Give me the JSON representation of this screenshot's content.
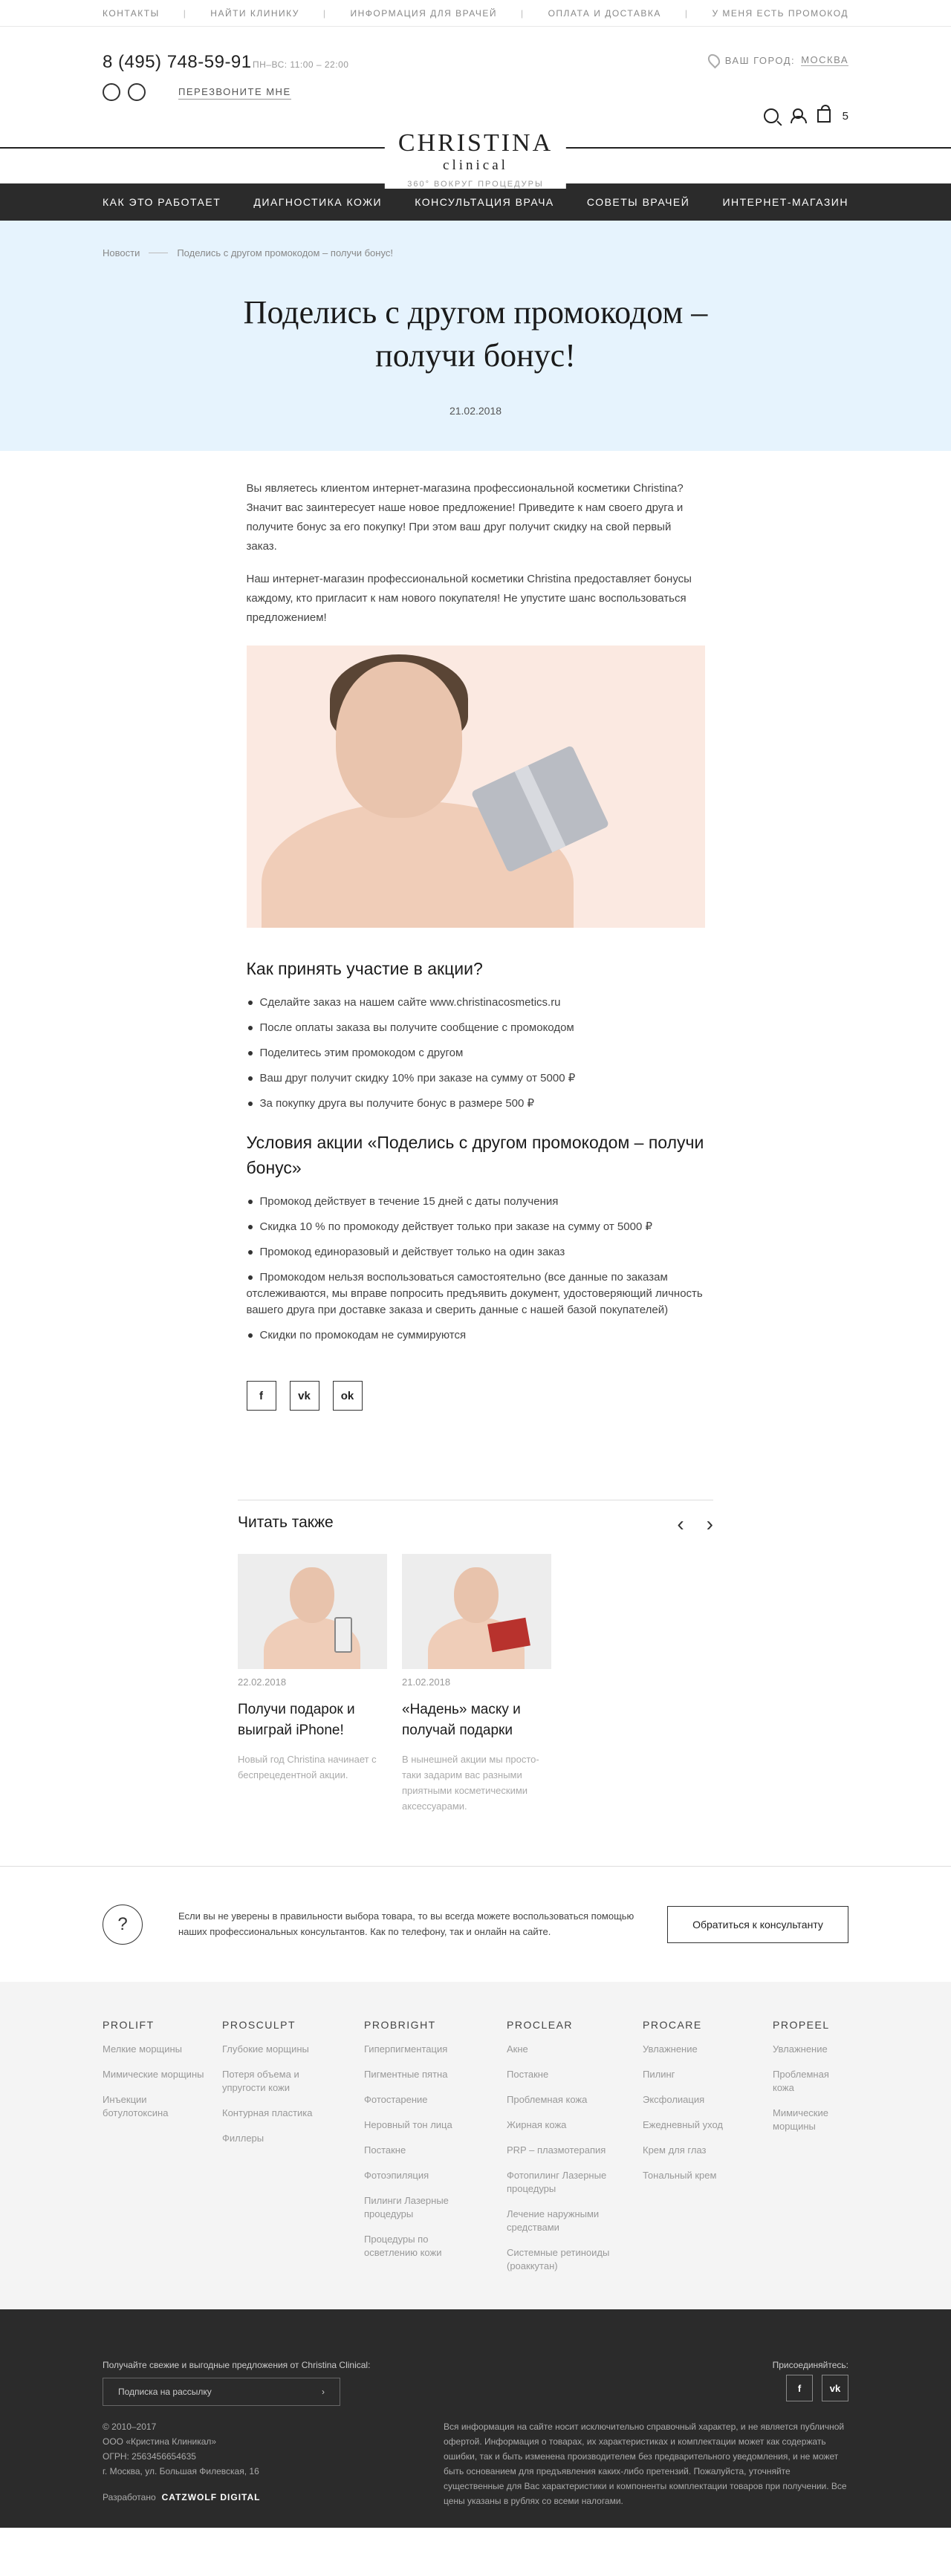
{
  "topbar": {
    "links": [
      "Контакты",
      "Найти клинику",
      "Информация для врачей",
      "Оплата и доставка",
      "У меня есть промокод"
    ]
  },
  "header": {
    "phone": "8 (495) 748-59-91",
    "hours": "ПН–ВС: 11:00 – 22:00",
    "callback": "Перезвоните мне",
    "city_label": "Ваш город:",
    "city": "Москва",
    "cart_count": "5",
    "logo_main": "CHRISTINA",
    "logo_sub": "clinical",
    "logo_tag": "360° вокруг процедуры"
  },
  "nav": [
    "Как это работает",
    "Диагностика кожи",
    "Консультация врача",
    "Советы врачей",
    "Интернет-магазин"
  ],
  "hero": {
    "breadcrumbs": [
      "Новости",
      "Поделись с другом промокодом – получи бонус!"
    ],
    "title": "Поделись с другом промокодом – получи бонус!",
    "date": "21.02.2018"
  },
  "article": {
    "p1": "Вы являетесь клиентом интернет-магазина профессиональной косметики Christina? Значит вас заинтересует наше новое предложение! Приведите к нам своего друга и получите бонус за его покупку! При этом ваш друг получит скидку на свой первый заказ.",
    "p2": "Наш интернет-магазин профессиональной косметики Christina предоставляет бонусы каждому, кто пригласит к нам нового покупателя! Не упустите шанс воспользоваться предложением!",
    "h_how": "Как принять участие в акции?",
    "how": [
      "Сделайте заказ на нашем сайте www.christinacosmetics.ru",
      "После оплаты заказа вы получите сообщение с промокодом",
      "Поделитесь этим промокодом с другом",
      "Ваш друг получит скидку 10% при заказе на сумму от 5000 ₽",
      "За покупку друга вы получите бонус в размере 500 ₽"
    ],
    "h_cond": "Условия акции «Поделись с другом промокодом – получи бонус»",
    "cond": [
      "Промокод действует в течение 15 дней с даты получения",
      "Скидка 10 % по промокоду действует только при заказе на сумму от 5000 ₽",
      "Промокод единоразовый и действует только на один заказ",
      "Промокодом нельзя воспользоваться самостоятельно (все данные по заказам отслеживаются, мы вправе попросить предъявить документ, удостоверяющий личность вашего друга при доставке заказа и сверить данные с нашей базой покупателей)",
      "Скидки по промокодам не суммируются"
    ],
    "share": [
      "f",
      "vk",
      "ok"
    ]
  },
  "also": {
    "title": "Читать также",
    "prev": "‹",
    "next": "›",
    "cards": [
      {
        "date": "22.02.2018",
        "title": "Получи подарок и выиграй iPhone!",
        "desc": "Новый год Christina начинает с беспрецедентной акции."
      },
      {
        "date": "21.02.2018",
        "title": "«Надень» маску и получай подарки",
        "desc": "В нынешней акции мы просто-таки задарим вас разными приятными косметическими аксессуарами."
      }
    ]
  },
  "consult": {
    "icon": "?",
    "text": "Если вы не уверены в правильности выбора товара, то вы всегда можете воспользоваться помощью наших профессиональных консультантов. Как по телефону, так и онлайн на сайте.",
    "button": "Обратиться к консультанту"
  },
  "footer_cols": [
    {
      "title": "Prolift",
      "items": [
        "Мелкие морщины",
        "Мимические морщины",
        "Инъекции ботулотоксина"
      ]
    },
    {
      "title": "Prosculpt",
      "items": [
        "Глубокие морщины",
        "Потеря объема и упругости кожи",
        "Контурная пластика",
        "Филлеры"
      ]
    },
    {
      "title": "Probright",
      "items": [
        "Гиперпигментация",
        "Пигментные пятна",
        "Фотостарение",
        "Неровный тон лица",
        "Постакне",
        "Фотоэпиляция",
        "Пилинги Лазерные процедуры",
        "Процедуры по осветлению кожи"
      ]
    },
    {
      "title": "Proclear",
      "items": [
        "Акне",
        "Постакне",
        "Проблемная кожа",
        "Жирная кожа",
        "PRP – плазмотерапия",
        "Фотопилинг Лазерные процедуры",
        "Лечение наружными средствами",
        "Системные ретиноиды (роаккутан)"
      ]
    },
    {
      "title": "Procare",
      "items": [
        "Увлажнение",
        "Пилинг",
        "Эксфолиация",
        "Ежедневный уход",
        "Крем для глаз",
        "Тональный крем"
      ]
    },
    {
      "title": "Propeel",
      "items": [
        "Увлажнение",
        "Проблемная кожа",
        "Мимические морщины"
      ]
    }
  ],
  "footer": {
    "sub_label": "Получайте свежие и выгодные предложения от Christina Clinical:",
    "sub_placeholder": "Подписка на рассылку",
    "sub_arrow": "›",
    "join": "Присоединяйтесь:",
    "social": [
      "f",
      "vk"
    ],
    "copy": [
      "© 2010–2017",
      "ООО «Кристина Клиникал»",
      "ОГРН: 2563456654635",
      "г. Москва, ул. Большая Филевская, 16"
    ],
    "dev_label": "Разработано",
    "dev_name": "CATZWOLF DIGITAL",
    "legal": "Вся информация на сайте носит исключительно справочный характер, и не является публичной офертой. Информация о товарах, их характеристиках и комплектации может как содержать ошибки, так и быть изменена производителем без предварительного уведомления, и не может быть основанием для предъявления каких-либо претензий. Пожалуйста, уточняйте существенные для Вас характеристики и компоненты комплектации товаров при получении. Все цены указаны в рублях со всеми налогами."
  }
}
